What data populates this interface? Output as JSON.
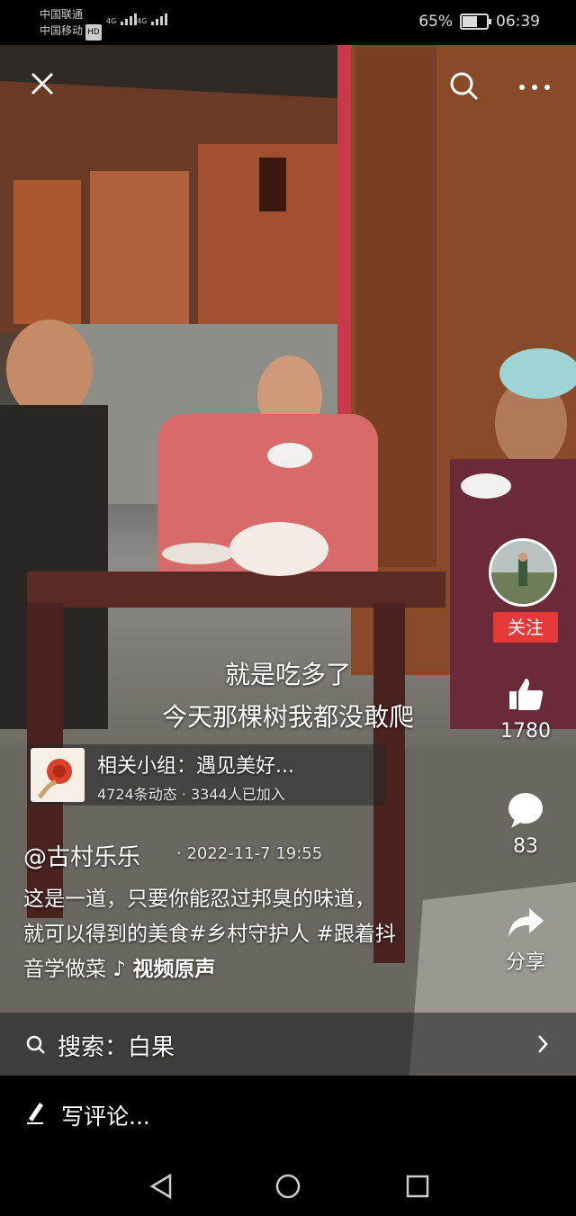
{
  "status_bar": {
    "carrier_1": "中国联通",
    "carrier_2": "中国移动",
    "hd_badge": "HD",
    "net_1": "4G",
    "net_2": "4G",
    "battery_percent": "65%",
    "battery_level": 0.65,
    "time": "06:39"
  },
  "video": {
    "subtitle_line_1": "就是吃多了",
    "subtitle_line_2": "今天那棵树我都没敢爬"
  },
  "side_actions": {
    "follow_label": "关注",
    "likes_count": "1780",
    "comments_count": "83",
    "share_label": "分享"
  },
  "group_card": {
    "title": "相关小组：遇见美好...",
    "stats": "4724条动态 · 3344人已加入"
  },
  "author": {
    "handle": "@古村乐乐",
    "date": "· 2022-11-7 19:55"
  },
  "description": {
    "line_1": "这是一道，只要你能忍过邦臭的味道，",
    "line_2": "就可以得到的美食#乡村守护人 #跟着抖",
    "line_3": "音学做菜",
    "music": "视频原声"
  },
  "search": {
    "label": "搜索：白果"
  },
  "comment": {
    "placeholder": "写评论..."
  },
  "colors": {
    "follow_red": "#e53a3a",
    "background": "#000000"
  }
}
